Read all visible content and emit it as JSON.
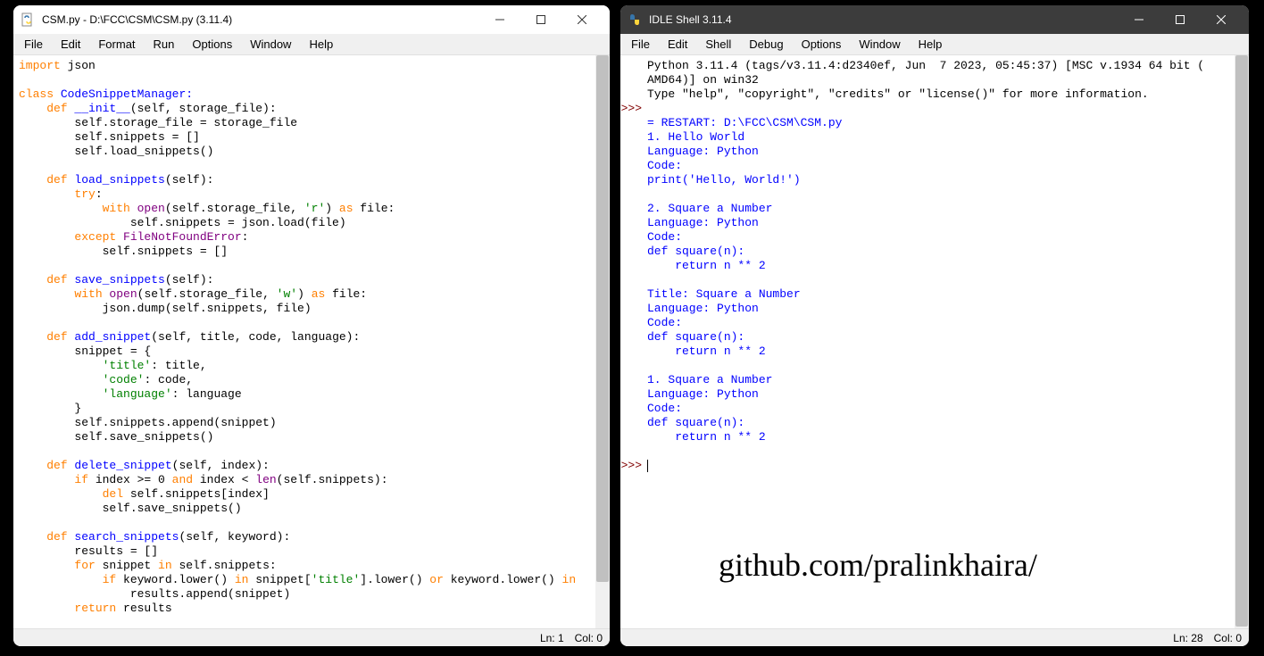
{
  "editor": {
    "title": "CSM.py - D:\\FCC\\CSM\\CSM.py (3.11.4)",
    "menus": [
      "File",
      "Edit",
      "Format",
      "Run",
      "Options",
      "Window",
      "Help"
    ],
    "status_ln": "Ln: 1",
    "status_col": "Col: 0",
    "code": {
      "l01a": "import",
      "l01b": " json",
      "l03a": "class",
      "l03b": " CodeSnippetManager:",
      "l04a": "    def",
      "l04b": " __init__",
      "l04c": "(self, storage_file):",
      "l05": "        self.storage_file = storage_file",
      "l06": "        self.snippets = []",
      "l07": "        self.load_snippets()",
      "l09a": "    def",
      "l09b": " load_snippets",
      "l09c": "(self):",
      "l10a": "        try",
      "l10b": ":",
      "l11a": "            with",
      "l11b": " open",
      "l11c": "(self.storage_file, ",
      "l11d": "'r'",
      "l11e": ") ",
      "l11f": "as",
      "l11g": " file:",
      "l12": "                self.snippets = json.load(file)",
      "l13a": "        except",
      "l13b": " FileNotFoundError",
      "l13c": ":",
      "l14": "            self.snippets = []",
      "l16a": "    def",
      "l16b": " save_snippets",
      "l16c": "(self):",
      "l17a": "        with",
      "l17b": " open",
      "l17c": "(self.storage_file, ",
      "l17d": "'w'",
      "l17e": ") ",
      "l17f": "as",
      "l17g": " file:",
      "l18": "            json.dump(self.snippets, file)",
      "l20a": "    def",
      "l20b": " add_snippet",
      "l20c": "(self, title, code, language):",
      "l21": "        snippet = {",
      "l22a": "            ",
      "l22b": "'title'",
      "l22c": ": title,",
      "l23a": "            ",
      "l23b": "'code'",
      "l23c": ": code,",
      "l24a": "            ",
      "l24b": "'language'",
      "l24c": ": language",
      "l25": "        }",
      "l26": "        self.snippets.append(snippet)",
      "l27": "        self.save_snippets()",
      "l29a": "    def",
      "l29b": " delete_snippet",
      "l29c": "(self, index):",
      "l30a": "        if",
      "l30b": " index >= 0 ",
      "l30c": "and",
      "l30d": " index < ",
      "l30e": "len",
      "l30f": "(self.snippets):",
      "l31a": "            del",
      "l31b": " self.snippets[index]",
      "l32": "            self.save_snippets()",
      "l34a": "    def",
      "l34b": " search_snippets",
      "l34c": "(self, keyword):",
      "l35": "        results = []",
      "l36a": "        for",
      "l36b": " snippet ",
      "l36c": "in",
      "l36d": " self.snippets:",
      "l37a": "            if",
      "l37b": " keyword.lower() ",
      "l37c": "in",
      "l37d": " snippet[",
      "l37e": "'title'",
      "l37f": "].lower() ",
      "l37g": "or",
      "l37h": " keyword.lower() ",
      "l37i": "in",
      "l38": "                results.append(snippet)",
      "l39a": "        return",
      "l39b": " results"
    }
  },
  "shell": {
    "title": "IDLE Shell 3.11.4",
    "menus": [
      "File",
      "Edit",
      "Shell",
      "Debug",
      "Options",
      "Window",
      "Help"
    ],
    "status_ln": "Ln: 28",
    "status_col": "Col: 0",
    "prompt": ">>>",
    "banner1": "Python 3.11.4 (tags/v3.11.4:d2340ef, Jun  7 2023, 05:45:37) [MSC v.1934 64 bit (",
    "banner2": "AMD64)] on win32",
    "banner3": "Type \"help\", \"copyright\", \"credits\" or \"license()\" for more information.",
    "out": {
      "restart": "= RESTART: D:\\FCC\\CSM\\CSM.py ",
      "o01": "1. Hello World",
      "o02": "Language: Python",
      "o03": "Code:",
      "o04": "print('Hello, World!')",
      "o05": "2. Square a Number",
      "o06": "Language: Python",
      "o07": "Code:",
      "o08": "def square(n):",
      "o09": "    return n ** 2",
      "o10": "Title: Square a Number",
      "o11": "Language: Python",
      "o12": "Code:",
      "o13": "def square(n):",
      "o14": "    return n ** 2",
      "o15": "1. Square a Number",
      "o16": "Language: Python",
      "o17": "Code:",
      "o18": "def square(n):",
      "o19": "    return n ** 2"
    }
  },
  "watermark": "github.com/pralinkhaira/"
}
